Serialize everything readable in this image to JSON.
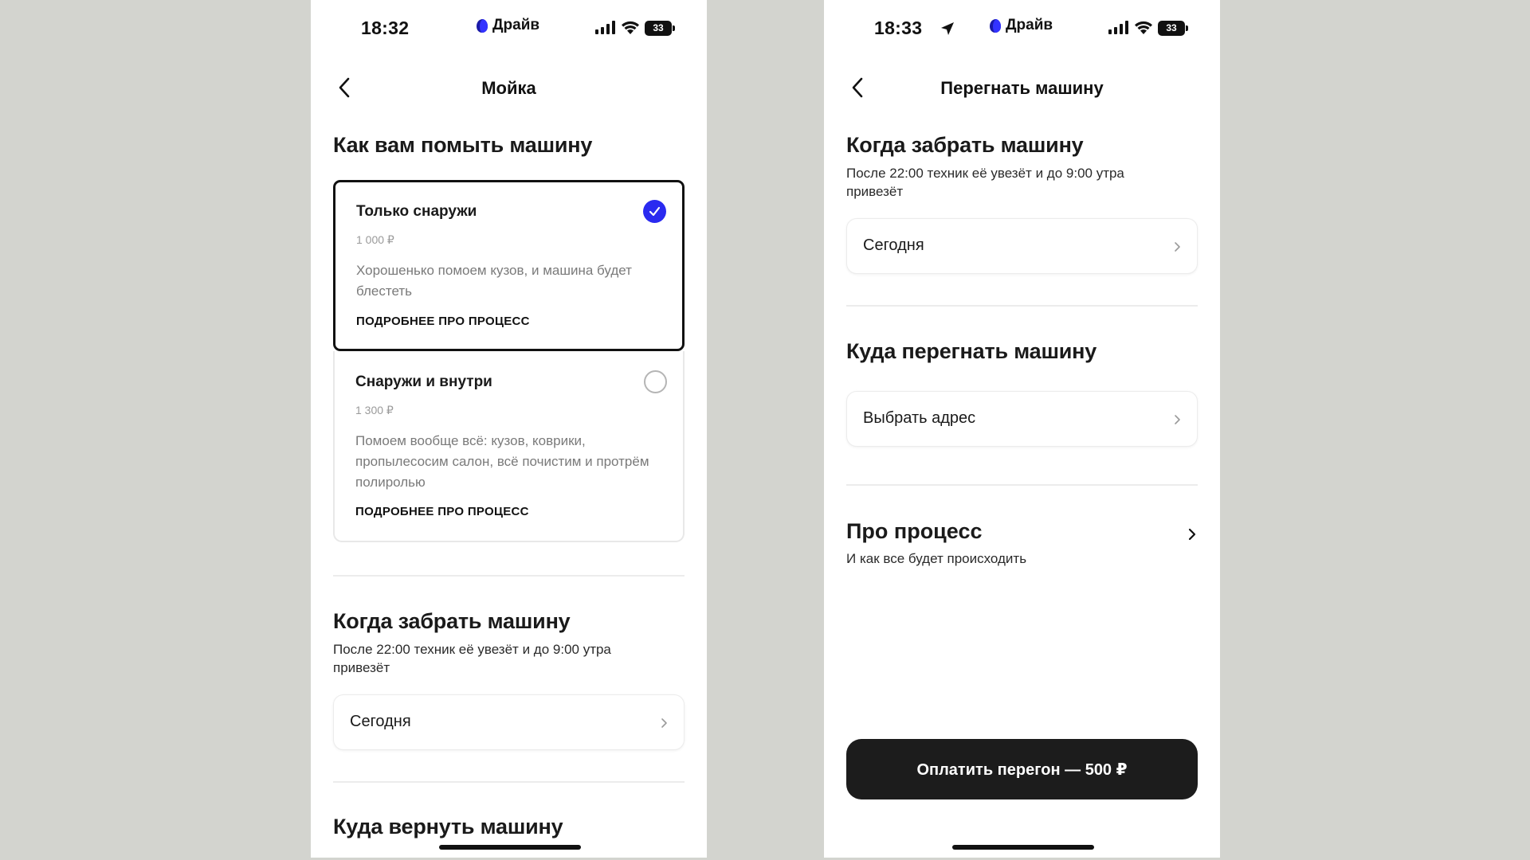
{
  "left_screen": {
    "status": {
      "time": "18:32",
      "brand": "Драйв",
      "battery": "33"
    },
    "nav_title": "Мойка",
    "wash_heading": "Как вам помыть машину",
    "options": [
      {
        "title": "Только снаружи",
        "price": "1 000 ₽",
        "description": "Хорошенько помоем кузов, и машина будет блестеть",
        "link": "ПОДРОБНЕЕ ПРО ПРОЦЕСС",
        "selected": true
      },
      {
        "title": "Снаружи и внутри",
        "price": "1 300 ₽",
        "description": "Помоем вообще всё: кузов, коврики, пропылесосим салон, всё почистим и протрём полиролью",
        "link": "ПОДРОБНЕЕ ПРО ПРОЦЕСС",
        "selected": false
      }
    ],
    "pickup_heading": "Когда забрать  машину",
    "pickup_sub": "После 22:00 техник её увезёт и до 9:00 утра привезёт",
    "pickup_value": "Сегодня",
    "return_heading": "Куда вернуть машину"
  },
  "right_screen": {
    "status": {
      "time": "18:33",
      "brand": "Драйв",
      "battery": "33"
    },
    "nav_title": "Перегнать машину",
    "pickup_heading": "Когда забрать  машину",
    "pickup_sub": "После 22:00 техник её увезёт и до 9:00 утра привезёт",
    "pickup_value": "Сегодня",
    "destination_heading": "Куда перегнать машину",
    "destination_value": "Выбрать адрес",
    "process_title": "Про процесс",
    "process_sub": "И как все будет происходить",
    "pay_button": "Оплатить перегон — 500 ₽"
  },
  "colors": {
    "background": "#d3d4cf",
    "accent": "#2a2af0",
    "button_dark": "#1c1c1c"
  },
  "icons": [
    "back-chevron-icon",
    "check-icon",
    "chevron-right-icon",
    "location-arrow-icon",
    "signal-icon",
    "wifi-icon",
    "battery-icon",
    "brand-logo-icon"
  ]
}
